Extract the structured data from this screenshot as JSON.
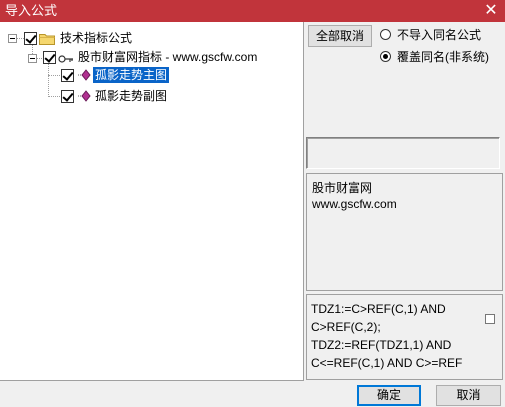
{
  "window": {
    "title": "导入公式",
    "close_glyph": "✕"
  },
  "tree": {
    "root": {
      "label": "技术指标公式",
      "checked": true
    },
    "group": {
      "label": "股市财富网指标 - www.gscfw.com",
      "checked": true
    },
    "items": [
      {
        "label": "孤影走势主图",
        "checked": true,
        "selected": true
      },
      {
        "label": "孤影走势副图",
        "checked": true,
        "selected": false
      }
    ]
  },
  "options": {
    "deselect_all_label": "全部取消",
    "radios": [
      {
        "label": "不导入同名公式",
        "checked": false
      },
      {
        "label": "覆盖同名(非系统)",
        "checked": true
      }
    ]
  },
  "info": {
    "text": "股市财富网\nwww.gscfw.com"
  },
  "formula": {
    "text": "TDZ1:=C>REF(C,1) AND C>REF(C,2);\nTDZ2:=REF(TDZ1,1) AND C<=REF(C,1) AND C>=REF"
  },
  "buttons": {
    "ok_label": "确定",
    "cancel_label": "取消"
  },
  "icons": {
    "folder": "folder-icon",
    "key": "key-icon",
    "diamond": "diamond-icon"
  },
  "colors": {
    "titlebar": "#c1343b",
    "selection": "#0a64c8",
    "folder": "#f5d76e",
    "diamond": "#b03090"
  }
}
